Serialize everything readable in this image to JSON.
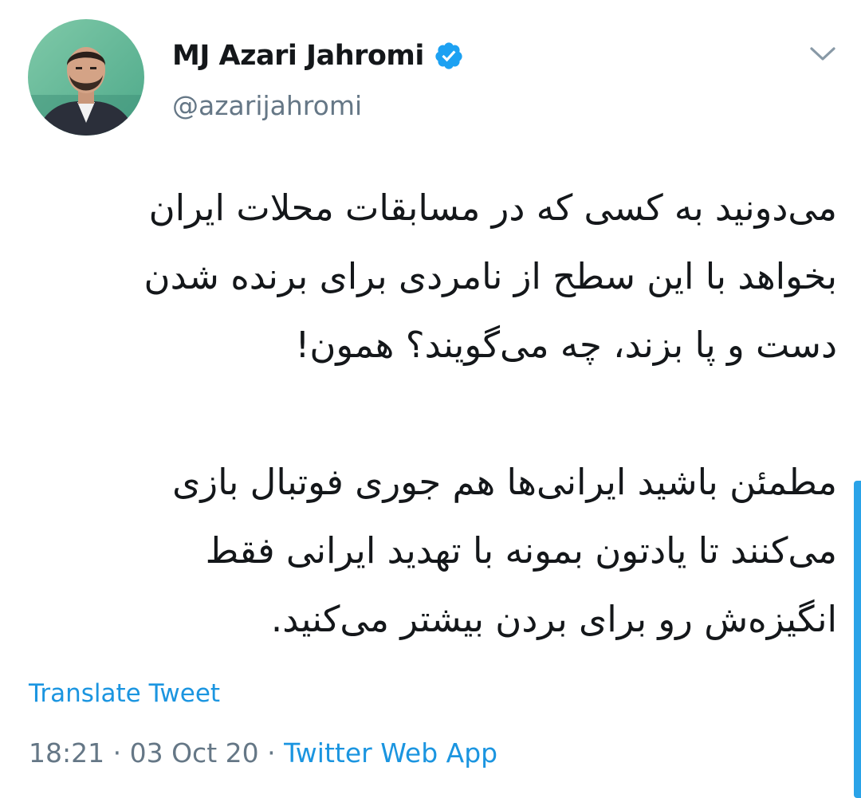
{
  "author": {
    "display_name": "MJ Azari Jahromi",
    "handle": "@azarijahromi",
    "verified": true,
    "verified_badge_icon": "verified-badge-icon",
    "accent_color": "#1da1f2"
  },
  "tweet": {
    "lines": [
      "می‌دونید به کسی که در مسابقات محلات ایران",
      "بخواهد با این سطح از نامردی برای برنده شدن",
      "دست و پا بزند، چه می‌گویند؟ همون!",
      "",
      "مطمئن باشید ایرانی‌ها هم جوری فوتبال بازی",
      "می‌کنند تا یادتون بمونه با تهدید ایرانی فقط",
      "انگیزه‌ش رو برای بردن بیشتر می‌کنید."
    ]
  },
  "translate_label": "Translate Tweet",
  "meta": {
    "time": "18:21",
    "separator": " · ",
    "date": "03 Oct 20",
    "source": "Twitter Web App"
  },
  "colors": {
    "link": "#1b95e0",
    "secondary_text": "#657786",
    "primary_text": "#14171a"
  }
}
